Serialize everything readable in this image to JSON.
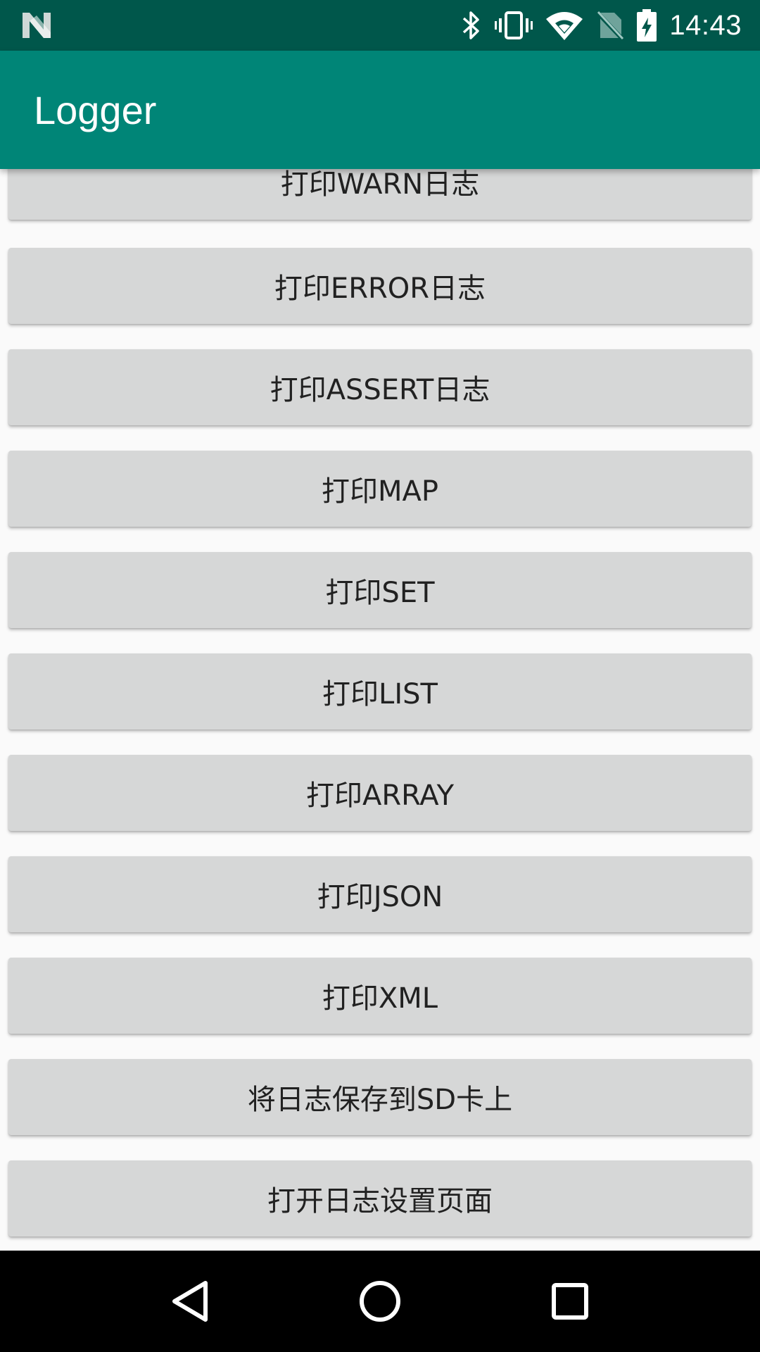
{
  "status_bar": {
    "time": "14:43",
    "icons": [
      "notification-n-icon",
      "bluetooth-icon",
      "vibrate-icon",
      "wifi-icon",
      "no-sim-icon",
      "battery-charging-icon"
    ]
  },
  "app_bar": {
    "title": "Logger",
    "color": "#008577",
    "status_color": "#00574b"
  },
  "buttons": [
    {
      "label": "打印WARN日志"
    },
    {
      "label": "打印ERROR日志"
    },
    {
      "label": "打印ASSERT日志"
    },
    {
      "label": "打印MAP"
    },
    {
      "label": "打印SET"
    },
    {
      "label": "打印LIST"
    },
    {
      "label": "打印ARRAY"
    },
    {
      "label": "打印JSON"
    },
    {
      "label": "打印XML"
    },
    {
      "label": "将日志保存到SD卡上"
    },
    {
      "label": "打开日志设置页面"
    }
  ],
  "nav_bar": {
    "icons": [
      "back-icon",
      "home-icon",
      "recents-icon"
    ]
  }
}
